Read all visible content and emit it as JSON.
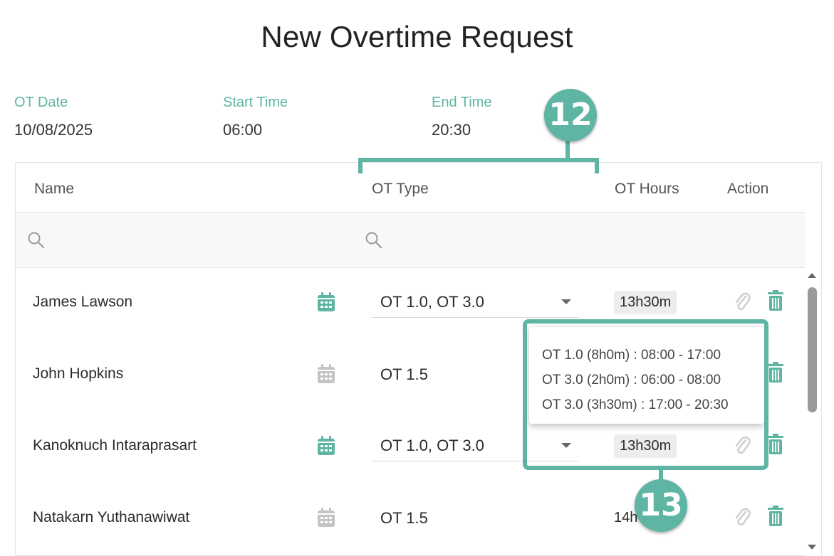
{
  "page": {
    "title": "New Overtime Request"
  },
  "fields": {
    "ot_date": {
      "label": "OT Date",
      "value": "10/08/2025"
    },
    "start_time": {
      "label": "Start Time",
      "value": "06:00"
    },
    "end_time": {
      "label": "End Time",
      "value": "20:30"
    }
  },
  "table": {
    "headers": {
      "name": "Name",
      "ot_type": "OT Type",
      "ot_hours": "OT Hours",
      "action": "Action"
    },
    "rows": [
      {
        "name": "James Lawson",
        "ot_type": "OT 1.0, OT 3.0",
        "ot_hours": "13h30m",
        "calendar": "active",
        "editable": true
      },
      {
        "name": "John Hopkins",
        "ot_type": "OT 1.5",
        "ot_hours": "",
        "calendar": "inactive",
        "editable": false
      },
      {
        "name": "Kanoknuch Intaraprasart",
        "ot_type": "OT 1.0, OT 3.0",
        "ot_hours": "13h30m",
        "calendar": "active",
        "editable": true
      },
      {
        "name": "Natakarn Yuthanawiwat",
        "ot_type": "OT 1.5",
        "ot_hours": "14h",
        "calendar": "inactive",
        "editable": false
      }
    ]
  },
  "tooltip": {
    "lines": [
      "OT 1.0 (8h0m) : 08:00 - 17:00",
      "OT 3.0 (2h0m) : 06:00 - 08:00",
      "OT 3.0 (3h30m) : 17:00 - 20:30"
    ]
  },
  "annotations": {
    "badge_12": "12",
    "badge_13": "13"
  },
  "icons": {
    "search": "search-icon",
    "calendar": "calendar-icon",
    "attach": "paperclip-icon",
    "delete": "trash-icon"
  },
  "colors": {
    "accent": "#5fb5a3",
    "icon_inactive": "#c4c4c4",
    "icon_muted": "#d0d0d0",
    "trash": "#5fb5a3"
  }
}
